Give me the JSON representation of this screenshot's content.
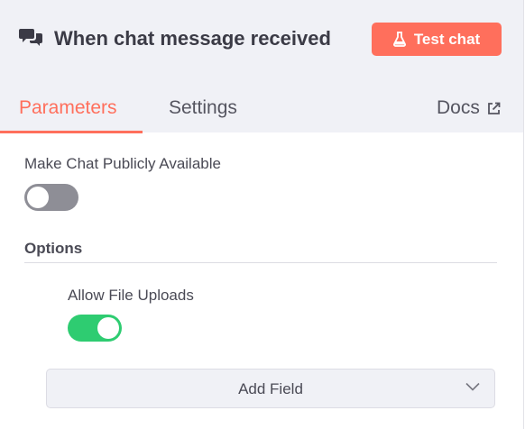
{
  "node": {
    "title": "When chat message received",
    "icon": "chat-bubbles-icon",
    "test_button": "Test chat",
    "test_button_icon": "flask-icon"
  },
  "tabs": [
    {
      "label": "Parameters",
      "active": true
    },
    {
      "label": "Settings",
      "active": false
    }
  ],
  "docs": {
    "label": "Docs",
    "icon": "external-link-icon"
  },
  "params": {
    "public_label": "Make Chat Publicly Available",
    "public_enabled": false,
    "options_title": "Options",
    "file_uploads_label": "Allow File Uploads",
    "file_uploads_enabled": true,
    "add_field_label": "Add Field"
  },
  "colors": {
    "accent": "#ff6f5c",
    "toggle_on": "#2ecc71",
    "toggle_off": "#8e8e96",
    "header_bg": "#f0f1f6"
  }
}
